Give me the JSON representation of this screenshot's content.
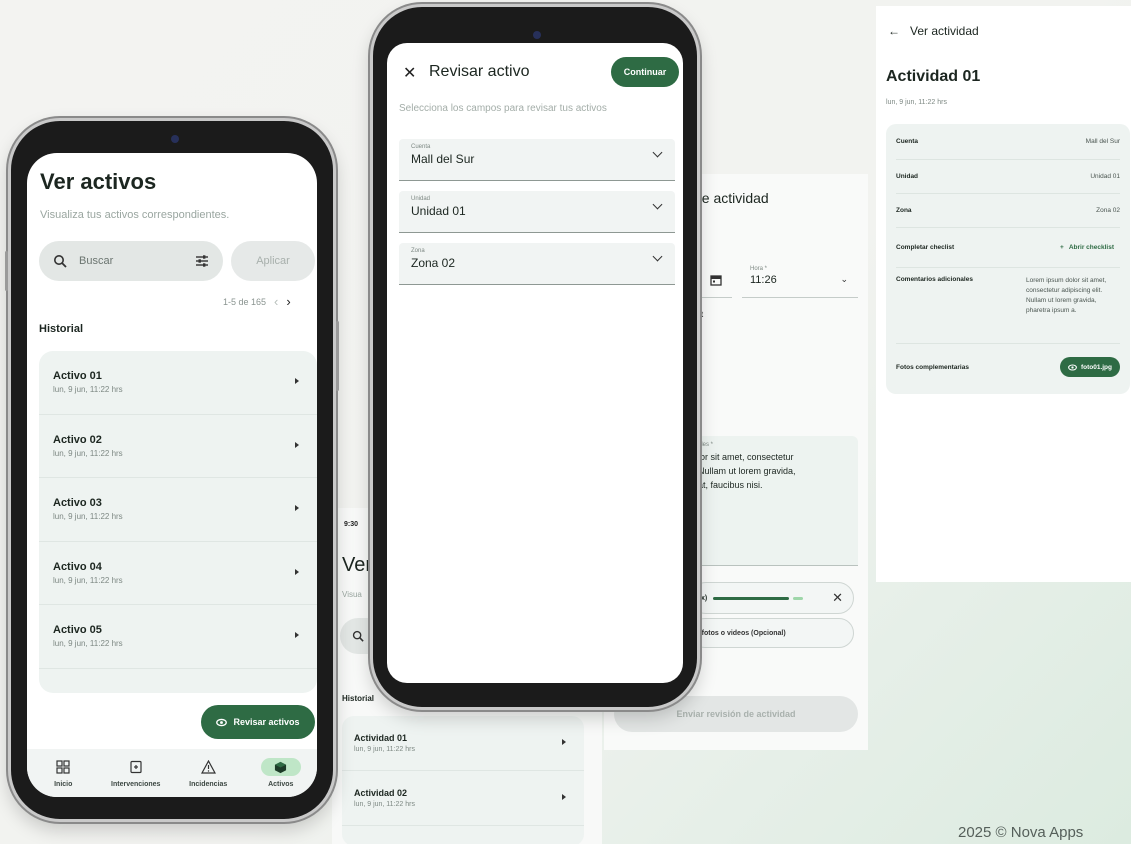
{
  "phone1": {
    "title": "Ver activos",
    "subtitle": "Visualiza tus activos correspondientes.",
    "search_placeholder": "Buscar",
    "apply_label": "Aplicar",
    "pagination": "1-5 de 165",
    "history_label": "Historial",
    "items": [
      {
        "title": "Activo 01",
        "date": "lun, 9 jun, 11:22 hrs"
      },
      {
        "title": "Activo 02",
        "date": "lun, 9 jun, 11:22 hrs"
      },
      {
        "title": "Activo 03",
        "date": "lun, 9 jun, 11:22 hrs"
      },
      {
        "title": "Activo 04",
        "date": "lun, 9 jun, 11:22 hrs"
      },
      {
        "title": "Activo 05",
        "date": "lun, 9 jun, 11:22 hrs"
      }
    ],
    "review_button": "Revisar activos",
    "nav": [
      {
        "label": "Inicio",
        "icon": "grid-icon"
      },
      {
        "label": "Intervenciones",
        "icon": "clipboard-icon"
      },
      {
        "label": "Incidencias",
        "icon": "warning-icon"
      },
      {
        "label": "Activos",
        "icon": "cube-icon",
        "active": true
      }
    ]
  },
  "phone2": {
    "title": "Revisar activo",
    "continue_label": "Continuar",
    "subtitle": "Selecciona los campos para revisar tus activos",
    "fields": [
      {
        "label": "Cuenta",
        "value": "Mall del Sur"
      },
      {
        "label": "Unidad",
        "value": "Unidad 01"
      },
      {
        "label": "Zona",
        "value": "Zona 02"
      }
    ]
  },
  "card_list": {
    "time": "9:30",
    "title": "Ver",
    "subtitle": "Visua",
    "history_label": "Historial",
    "items": [
      {
        "title": "Actividad 01",
        "date": "lun, 9 jun, 11:22 hrs"
      },
      {
        "title": "Actividad 02",
        "date": "lun, 9 jun, 11:22 hrs"
      }
    ]
  },
  "card_review": {
    "title": "de actividad",
    "hour_label": "Hora *",
    "hour_value": "11:26",
    "checklist_fragment": "et",
    "comments_label": "ales *",
    "comments_text": "lor sit amet, consectetur\nNullam ut lorem gravida,\nat, faucibus nisi.",
    "upload_fragment": "x)",
    "add_media_label": "r fotos o videos (Opcional)",
    "send_label": "Enviar revisión de actividad"
  },
  "card_activity": {
    "back_label": "Ver actividad",
    "title": "Actividad 01",
    "subtitle": "lun, 9 jun, 11:22 hrs",
    "rows": [
      {
        "key": "Cuenta",
        "value": "Mall del Sur"
      },
      {
        "key": "Unidad",
        "value": "Unidad 01"
      },
      {
        "key": "Zona",
        "value": "Zona 02"
      },
      {
        "key": "Completar checlist",
        "link": "Abrir checklist"
      },
      {
        "key": "Comentarios adicionales",
        "value": "Lorem ipsum dolor sit amet, consectetur adipiscing elit. Nullam ut lorem gravida, pharetra ipsum a."
      },
      {
        "key": "Fotos complementarias",
        "chip": "foto01.jpg"
      }
    ]
  },
  "footer": "2025 © Nova Apps",
  "colors": {
    "primary": "#2e6b44",
    "surface": "#eef3f1",
    "active_nav": "#bfe6c7"
  }
}
